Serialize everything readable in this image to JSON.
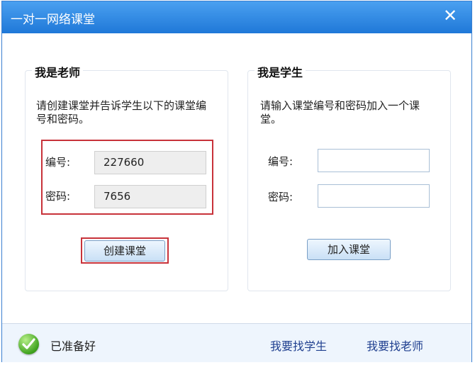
{
  "window": {
    "title": "一对一网络课堂",
    "close_label": "✕"
  },
  "teacher": {
    "title": "我是老师",
    "description": "请创建课堂并告诉学生以下的课堂编号和密码。",
    "id_label": "编号:",
    "id_value": "227660",
    "password_label": "密码:",
    "password_value": "7656",
    "create_button": "创建课堂"
  },
  "student": {
    "title": "我是学生",
    "description": "请输入课堂编号和密码加入一个课堂。",
    "id_label": "编号:",
    "id_value": "",
    "password_label": "密码:",
    "password_value": "",
    "join_button": "加入课堂"
  },
  "footer": {
    "status_text": "已准备好",
    "status_icon": "check-circle-icon",
    "find_student_link": "我要找学生",
    "find_teacher_link": "我要找老师"
  },
  "colors": {
    "titlebar": "#2b86e0",
    "highlight": "#c8323a",
    "link": "#1f3f8f",
    "footer_bg": "#eef5fd"
  }
}
